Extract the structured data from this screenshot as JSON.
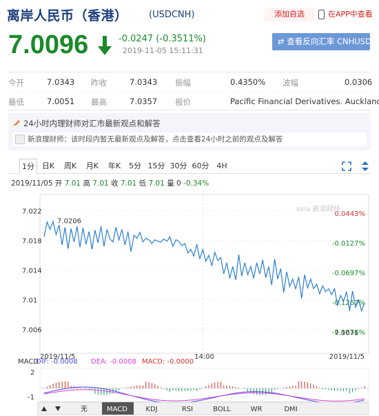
{
  "header": {
    "title": "离岸人民币（香港）",
    "code": "(USDCNH)",
    "watch_label": "添加自选",
    "app_label": "在APP中查看"
  },
  "quote": {
    "price": "7.0096",
    "change": "-0.0247 (-0.3511%)",
    "time": "2019-11-05 15:11:31",
    "reverse_label": "查看反向汇率 CNHUSD",
    "color_down": "#1a8a2a"
  },
  "stats": {
    "open_label": "今开",
    "open": "7.0343",
    "prev_label": "昨收",
    "prev": "7.0343",
    "amp_label": "振幅",
    "amp": "0.4350%",
    "wave_label": "波幅",
    "wave": "0.0306",
    "low_label": "最低",
    "low": "7.0051",
    "high_label": "最高",
    "high": "7.0357",
    "source_label": "报价",
    "source": "Pacific Financial Derivatives. Auckland"
  },
  "notice": {
    "title": "24小时内理财师对汇市最新观点和解答",
    "body": "新浪理财师：该时段内暂无最新观点及解答，点击查看24小时之前的观点及解答"
  },
  "tabs": [
    "1分",
    "日K",
    "周K",
    "月K",
    "年K",
    "5分",
    "15分",
    "30分",
    "60分",
    "4H"
  ],
  "quote_line": {
    "date": "2019/11/05",
    "open_label": "开",
    "open": "7.01",
    "high_label": "高",
    "high": "7.01",
    "close_label": "收",
    "close": "7.01",
    "low_label": "低",
    "low": "7.01",
    "vol_label": "量",
    "vol": "0",
    "pct": "-0.34%"
  },
  "indicator_tabs": [
    "无",
    "MACD",
    "KDJ",
    "RSI",
    "BOLL",
    "WR",
    "DMI"
  ],
  "chart_data": {
    "type": "line",
    "title": "",
    "x_labels": [
      "2019/11/5",
      "14:00",
      "2019/11/5"
    ],
    "y_ticks": [
      7.022,
      7.018,
      7.014,
      7.01,
      7.006
    ],
    "y_ticks_text": [
      "7.022",
      "7.018",
      "7.014",
      "7.01",
      "7.006"
    ],
    "ylim": [
      7.0028,
      7.0242
    ],
    "pct_labels": [
      "0.0443%",
      "-0.0127%",
      "-0.0697%",
      "-0.1267%",
      "-0.1836%"
    ],
    "pct_values": [
      7.0374,
      7.0334,
      7.0294,
      7.0254,
      7.0214
    ],
    "annotations": [
      {
        "text": "7.0206"
      },
      {
        "text": "7.0071"
      }
    ],
    "watermark": "sina 新浪财经",
    "series": [
      {
        "color": "#2a7fd0",
        "values": [
          7.0185,
          7.0205,
          7.0195,
          7.0206,
          7.0188,
          7.0201,
          7.0174,
          7.0198,
          7.0169,
          7.0196,
          7.0178,
          7.0199,
          7.0171,
          7.0197,
          7.0175,
          7.0192,
          7.0168,
          7.0194,
          7.0177,
          7.0199,
          7.0172,
          7.0195,
          7.0182,
          7.0178,
          7.0198,
          7.0181,
          7.0195,
          7.0174,
          7.0192,
          7.0165,
          7.0187,
          7.0183,
          7.0191,
          7.0178,
          7.0183,
          7.0181,
          7.0176,
          7.0181,
          7.0179,
          7.0178,
          7.0182,
          7.0179,
          7.0185,
          7.0172,
          7.0181,
          7.0179,
          7.0173,
          7.0176,
          7.0163,
          7.0168,
          7.0159,
          7.0175,
          7.0155,
          7.0168,
          7.0152,
          7.016,
          7.0146,
          7.0164,
          7.0153,
          7.0157,
          7.0135,
          7.015,
          7.0129,
          7.0145,
          7.0127,
          7.0161,
          7.0132,
          7.015,
          7.0134,
          7.0145,
          7.0129,
          7.015,
          7.0135,
          7.0154,
          7.013,
          7.0145,
          7.012,
          7.0155,
          7.0128,
          7.0142,
          7.011,
          7.0138,
          7.0118,
          7.0128,
          7.0115,
          7.0131,
          7.0102,
          7.0134,
          7.0116,
          7.0128,
          7.0115,
          7.0121,
          7.0108,
          7.0119,
          7.0111,
          7.0115,
          7.0107,
          7.0115,
          7.0092,
          7.0106,
          7.0098,
          7.0111,
          7.0085,
          7.0112,
          7.009,
          7.01,
          7.0085,
          7.0096
        ]
      }
    ],
    "macd": {
      "label": "MACD",
      "dif_label": "DIF: -0.0008",
      "dea_label": "DEA: -0.0008",
      "macd_label": "MACD: -0.0000",
      "dif_color": "#4a4ae0",
      "dea_color": "#d640d6",
      "macd_color": "#d63030",
      "y_ticks_text": [
        "2",
        "-1"
      ],
      "ylim": [
        -1.6,
        2.4
      ]
    }
  }
}
